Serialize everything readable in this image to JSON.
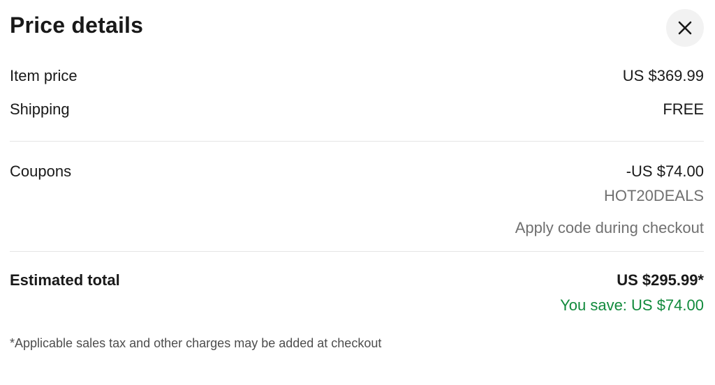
{
  "header": {
    "title": "Price details",
    "close_icon": "close-icon"
  },
  "lines": {
    "item_price": {
      "label": "Item price",
      "value": "US $369.99"
    },
    "shipping": {
      "label": "Shipping",
      "value": "FREE"
    }
  },
  "coupons": {
    "label": "Coupons",
    "amount": "-US $74.00",
    "code": "HOT20DEALS",
    "note": "Apply code during checkout"
  },
  "total": {
    "label": "Estimated total",
    "amount": "US $295.99*",
    "savings": "You save: US $74.00"
  },
  "footnote": "*Applicable sales tax and other charges may be added at checkout",
  "colors": {
    "savings": "#118a3c",
    "muted": "#707070",
    "close_bg": "#f2f2f2"
  }
}
